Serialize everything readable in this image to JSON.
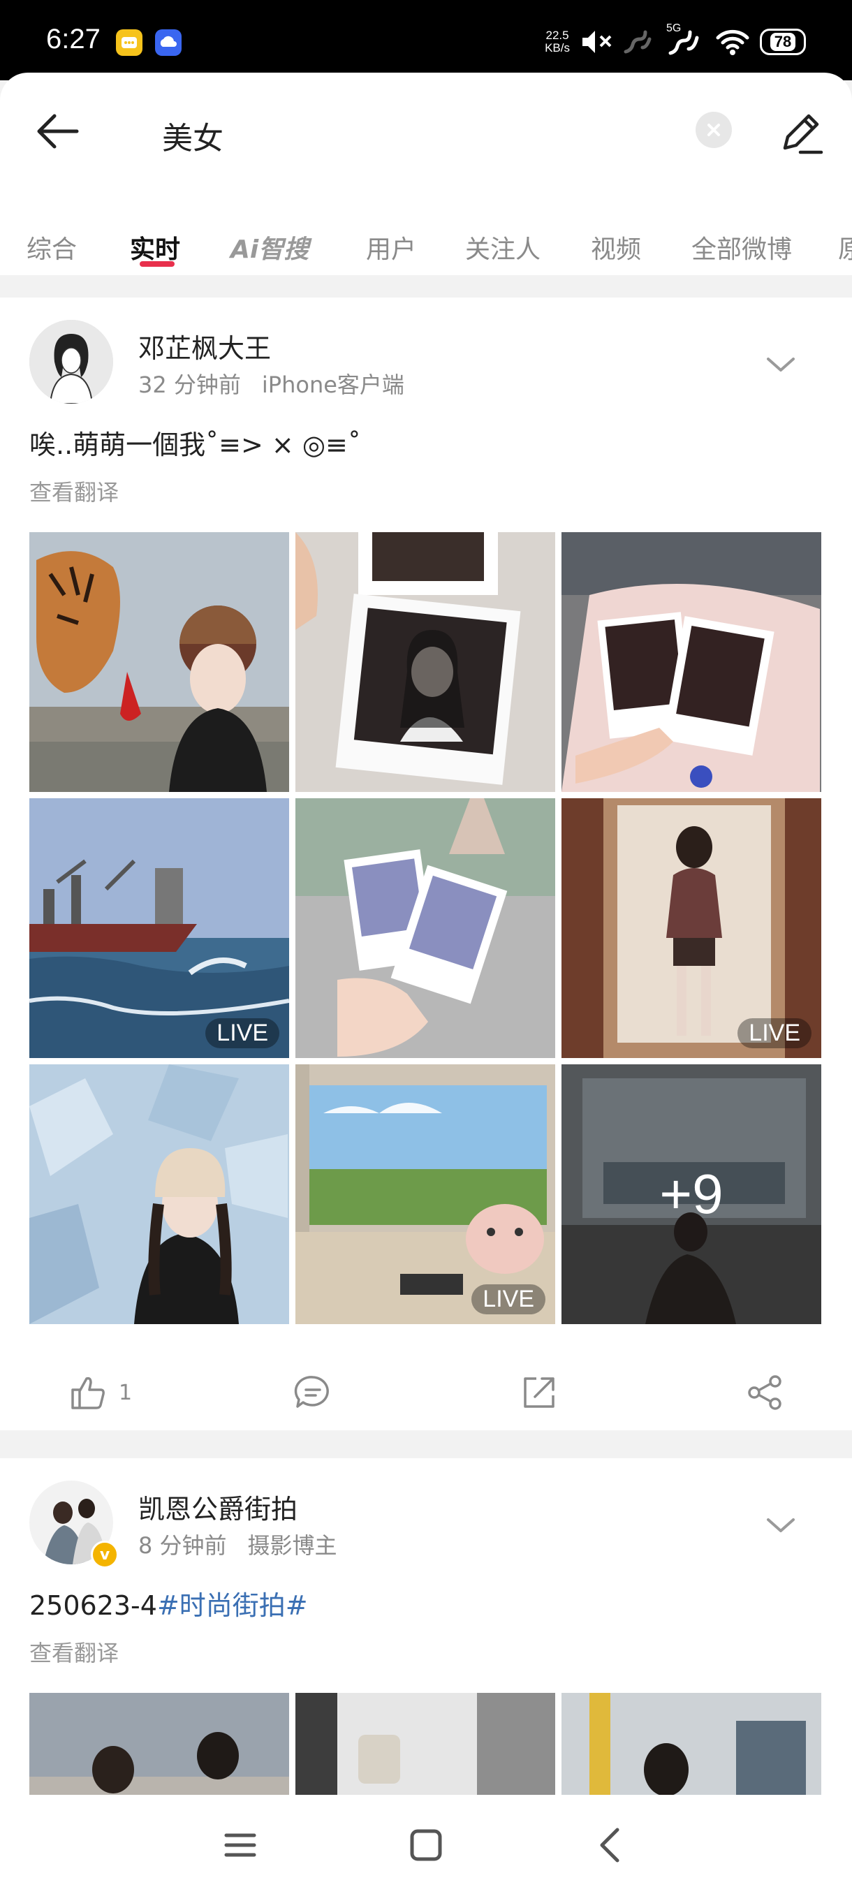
{
  "status_bar": {
    "time": "6:27",
    "net_speed_value": "22.5",
    "net_speed_unit": "KB/s",
    "signal_label": "5G",
    "battery": "78"
  },
  "header": {
    "search_query": "美女",
    "icons": [
      "back-arrow-icon",
      "clear-icon",
      "edit-icon"
    ]
  },
  "tabs": [
    {
      "label": "综合",
      "active": false
    },
    {
      "label": "实时",
      "active": true
    },
    {
      "label": "Ai智搜",
      "active": false
    },
    {
      "label": "用户",
      "active": false
    },
    {
      "label": "关注人",
      "active": false
    },
    {
      "label": "视频",
      "active": false
    },
    {
      "label": "全部微博",
      "active": false
    },
    {
      "label": "原",
      "active": false
    }
  ],
  "accent_color": "#e8304c",
  "posts": [
    {
      "username": "邓芷枫大王",
      "time": "32 分钟前",
      "source": "iPhone客户端",
      "text": "唉..萌萌一個我˚≡> × ◎≡˚",
      "translate_label": "查看翻译",
      "images": [
        {
          "label": "",
          "overlay": ""
        },
        {
          "label": "",
          "overlay": ""
        },
        {
          "label": "",
          "overlay": ""
        },
        {
          "label": "LIVE",
          "overlay": ""
        },
        {
          "label": "",
          "overlay": ""
        },
        {
          "label": "LIVE",
          "overlay": ""
        },
        {
          "label": "",
          "overlay": ""
        },
        {
          "label": "LIVE",
          "overlay": ""
        },
        {
          "label": "",
          "overlay": "+9"
        }
      ],
      "like_count": "1"
    },
    {
      "username": "凯恩公爵街拍",
      "time": "8 分钟前",
      "source": "摄影博主",
      "text_plain": "250623-4",
      "text_hashtag": "#时尚街拍#",
      "translate_label": "查看翻译"
    }
  ]
}
